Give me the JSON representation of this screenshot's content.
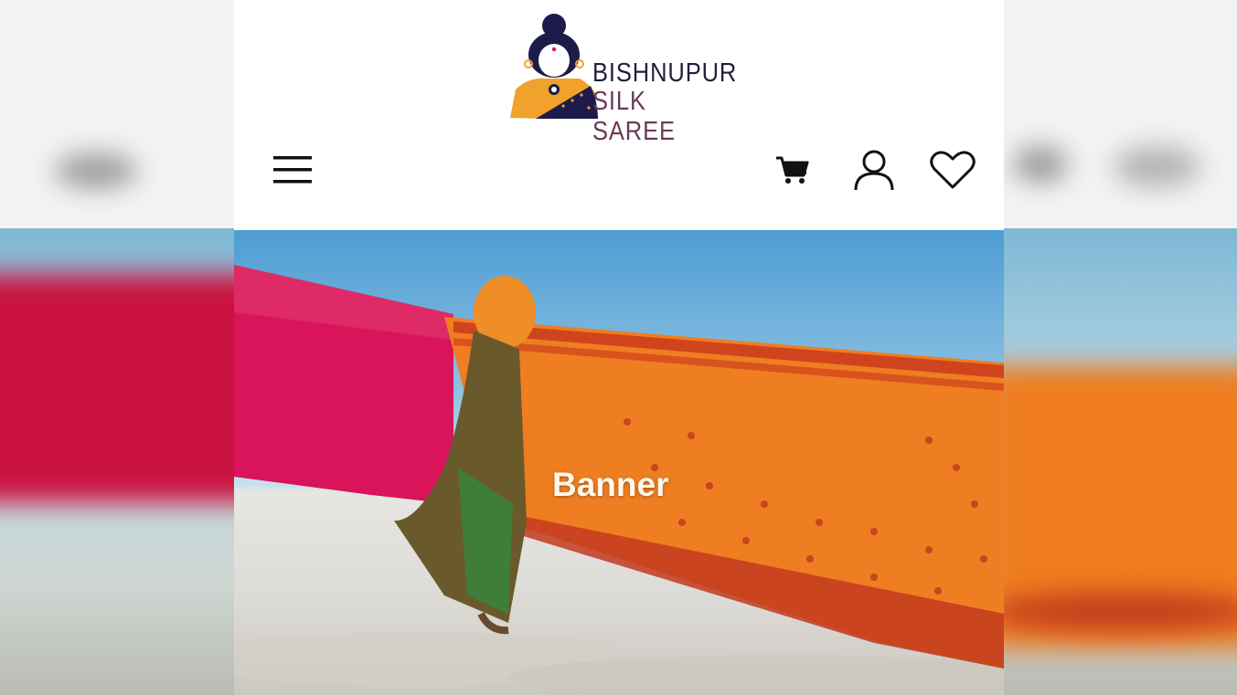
{
  "brand": {
    "line1": "BISHNUPUR",
    "line2": "SILK SAREE",
    "colors": {
      "navy": "#1c1b4a",
      "orange": "#f1a22c",
      "mauve": "#6b3a55"
    }
  },
  "header": {
    "icons": [
      "menu-icon",
      "cart-icon",
      "user-icon",
      "heart-icon"
    ]
  },
  "banner": {
    "label": "Banner",
    "colors": {
      "sky": "#4d9dd3",
      "sand": "#dcdad5",
      "pink": "#d9145a",
      "orange": "#ef7d22"
    }
  }
}
